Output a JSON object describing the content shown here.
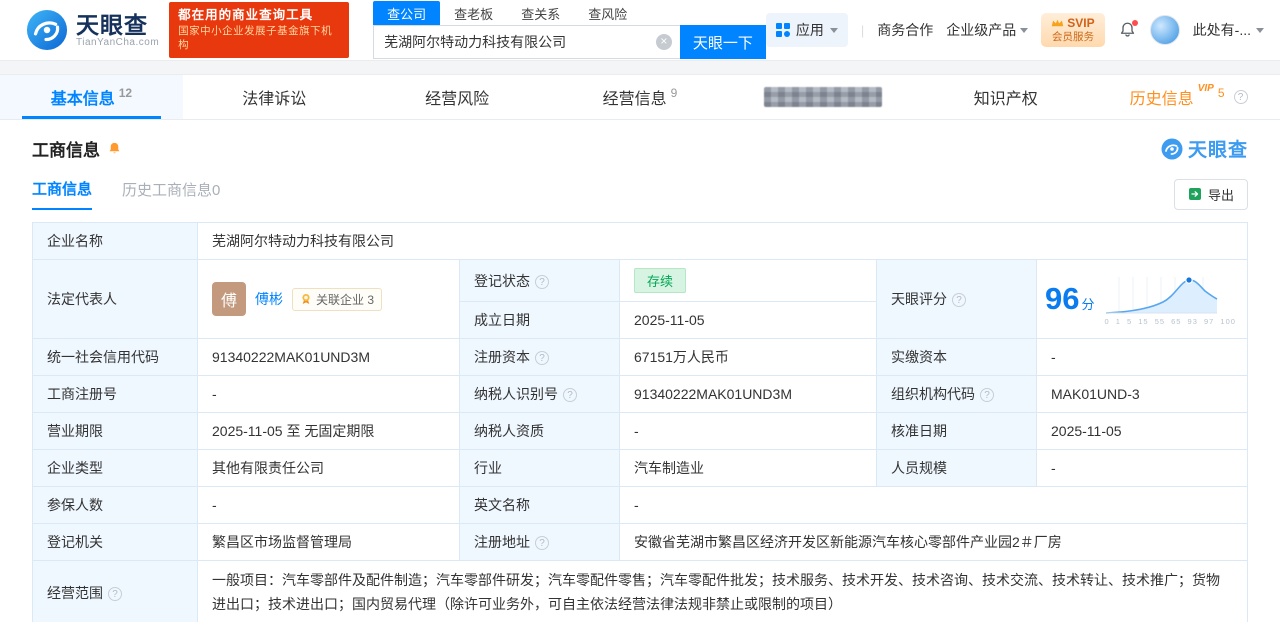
{
  "header": {
    "brand": "天眼查",
    "brand_domain": "TianYanCha.com",
    "slogan_line1": "都在用的商业查询工具",
    "slogan_line2": "国家中小企业发展子基金旗下机构",
    "search": {
      "tabs": [
        {
          "label": "查公司"
        },
        {
          "label": "查老板"
        },
        {
          "label": "查关系"
        },
        {
          "label": "查风险"
        }
      ],
      "value": "芜湖阿尔特动力科技有限公司",
      "button": "天眼一下"
    },
    "apps_label": "应用",
    "link_cooperation": "商务合作",
    "link_enterprise": "企业级产品",
    "svip_line1": "SVIP",
    "svip_line2": "会员服务",
    "user_name": "此处有-..."
  },
  "nav": {
    "tabs": [
      {
        "label": "基本信息",
        "count": "12"
      },
      {
        "label": "法律诉讼",
        "count": ""
      },
      {
        "label": "经营风险",
        "count": ""
      },
      {
        "label": "经营信息",
        "count": "9"
      },
      {
        "label": "",
        "count": ""
      },
      {
        "label": "知识产权",
        "count": ""
      },
      {
        "label": "历史信息",
        "count": "5",
        "vip": "VIP"
      }
    ]
  },
  "section": {
    "title": "工商信息",
    "watermark_brand": "天眼查",
    "subtab_active": "工商信息",
    "subtab_history": "历史工商信息0",
    "export_label": "导出"
  },
  "score": {
    "value": "96",
    "unit": "分",
    "axis": "0 1 5 15 55 65 93 97 100"
  },
  "fields": {
    "name": {
      "label": "企业名称",
      "value": "芜湖阿尔特动力科技有限公司"
    },
    "legal_rep": {
      "label": "法定代表人",
      "avatar": "傅",
      "value": "傅彬",
      "badge": "关联企业 3"
    },
    "reg_status": {
      "label": "登记状态",
      "value": "存续"
    },
    "est_date": {
      "label": "成立日期",
      "value": "2025-11-05"
    },
    "score_label": "天眼评分",
    "credit_code": {
      "label": "统一社会信用代码",
      "value": "91340222MAK01UND3M"
    },
    "reg_capital": {
      "label": "注册资本",
      "value": "67151万人民币"
    },
    "paid_capital": {
      "label": "实缴资本",
      "value": "-"
    },
    "reg_no": {
      "label": "工商注册号",
      "value": "-"
    },
    "taxpayer_id": {
      "label": "纳税人识别号",
      "value": "91340222MAK01UND3M"
    },
    "org_code": {
      "label": "组织机构代码",
      "value": "MAK01UND-3"
    },
    "term": {
      "label": "营业期限",
      "value": "2025-11-05 至 无固定期限"
    },
    "taxpayer_quality": {
      "label": "纳税人资质",
      "value": "-"
    },
    "approval_date": {
      "label": "核准日期",
      "value": "2025-11-05"
    },
    "company_type": {
      "label": "企业类型",
      "value": "其他有限责任公司"
    },
    "industry": {
      "label": "行业",
      "value": "汽车制造业"
    },
    "staff_size": {
      "label": "人员规模",
      "value": "-"
    },
    "insured_num": {
      "label": "参保人数",
      "value": "-"
    },
    "english_name": {
      "label": "英文名称",
      "value": "-"
    },
    "reg_authority": {
      "label": "登记机关",
      "value": "繁昌区市场监督管理局"
    },
    "address": {
      "label": "注册地址",
      "value": "安徽省芜湖市繁昌区经济开发区新能源汽车核心零部件产业园2＃厂房"
    },
    "scope": {
      "label": "经营范围",
      "value": "一般项目：汽车零部件及配件制造；汽车零部件研发；汽车零配件零售；汽车零配件批发；技术服务、技术开发、技术咨询、技术交流、技术转让、技术推广；货物进出口；技术进出口；国内贸易代理（除许可业务外，可自主依法经营法律法规非禁止或限制的项目）"
    }
  },
  "icons": {
    "logo": "wave-eye-swirl",
    "apps": "blue-grid",
    "bell": "bell-outline",
    "alarm": "orange-bell",
    "question": "?",
    "clear": "×",
    "export": "green-arrow-box",
    "crown": "gold-crown",
    "medal": "gold-medal"
  },
  "colors": {
    "brand_blue": "#0084ff",
    "badge_red": "#e8380d",
    "status_green": "#00a854",
    "vip_orange": "#ff8f1f"
  }
}
